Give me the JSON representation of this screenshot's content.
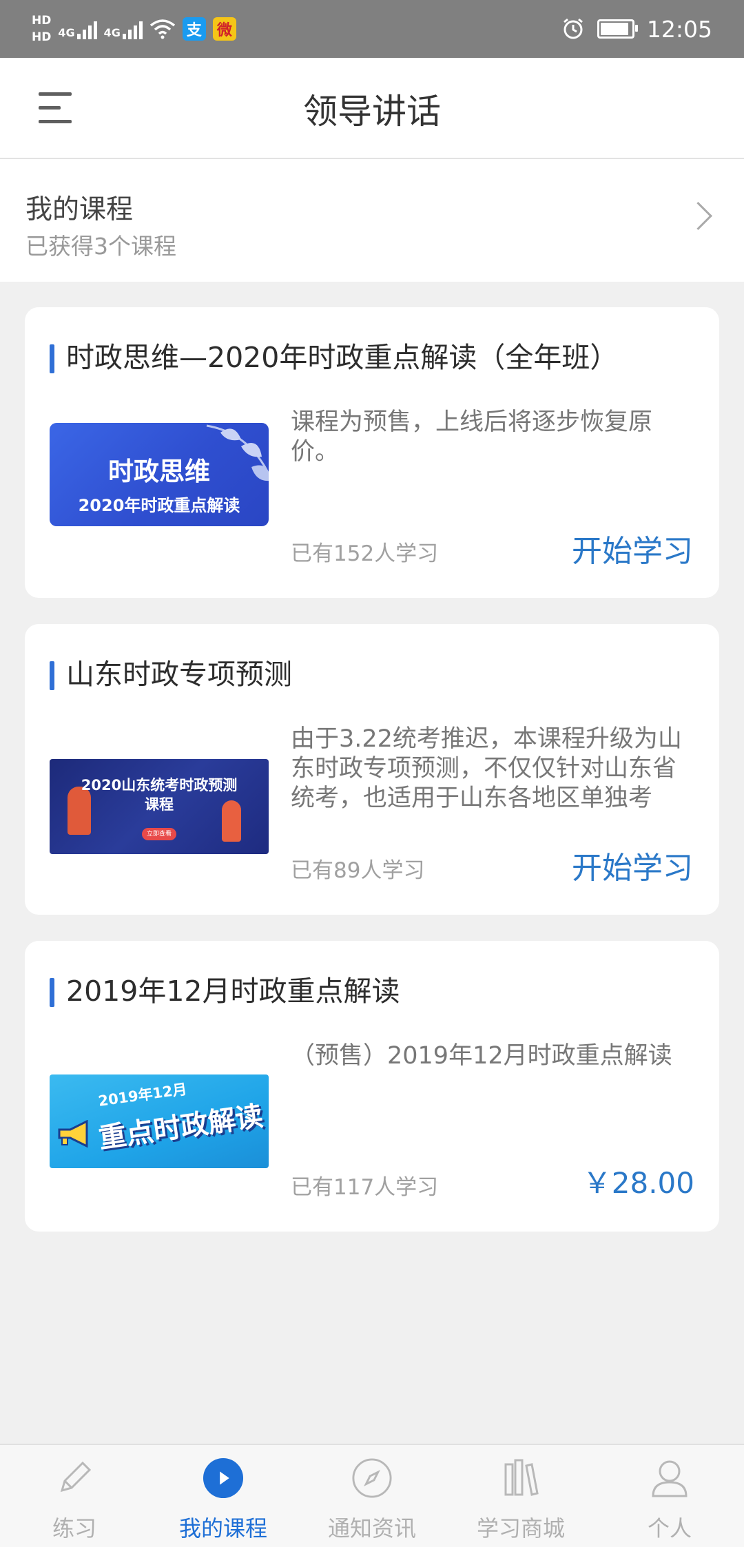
{
  "status_bar": {
    "hd1": "HD",
    "hd2": "HD",
    "net1": "4G",
    "net2": "4G",
    "alipay_glyph": "支",
    "weibo_glyph": "微",
    "time": "12:05"
  },
  "app_bar": {
    "title": "领导讲话"
  },
  "my_courses": {
    "title": "我的课程",
    "subtitle": "已获得3个课程"
  },
  "courses": [
    {
      "title": "时政思维—2020年时政重点解读（全年班）",
      "thumb_line1": "时政思维",
      "thumb_line2": "2020年时政重点解读",
      "description": "课程为预售，上线后将逐步恢复原价。",
      "learners": "已有152人学习",
      "action": "开始学习"
    },
    {
      "title": "山东时政专项预测",
      "thumb_line1": "2020山东统考时政预测",
      "thumb_line2": "课程",
      "thumb_button": "立即查看",
      "description": "由于3.22统考推迟，本课程升级为山东时政专项预测，不仅仅针对山东省统考，也适用于山东各地区单独考",
      "learners": "已有89人学习",
      "action": "开始学习"
    },
    {
      "title": "2019年12月时政重点解读",
      "thumb_line1": "2019年12月",
      "thumb_line2": "重点时政解读",
      "description": "（预售）2019年12月时政重点解读",
      "learners": "已有117人学习",
      "price": "￥28.00"
    }
  ],
  "bottom_nav": [
    {
      "label": "练习",
      "icon": "pencil-icon"
    },
    {
      "label": "我的课程",
      "icon": "play-icon"
    },
    {
      "label": "通知资讯",
      "icon": "compass-icon"
    },
    {
      "label": "学习商城",
      "icon": "books-icon"
    },
    {
      "label": "个人",
      "icon": "person-icon"
    }
  ],
  "colors": {
    "accent": "#2a78c8",
    "nav_active": "#1e6fd6",
    "card_bar": "#2f6fd6",
    "status_bar": "#808080"
  }
}
